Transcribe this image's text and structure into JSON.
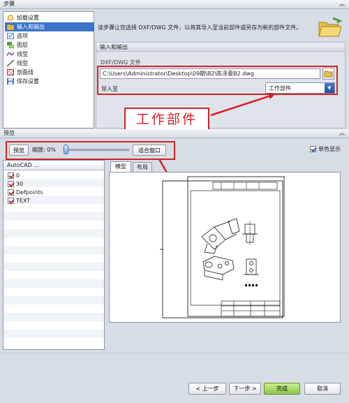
{
  "steps_header": "步骤",
  "steps": [
    {
      "label": "加载设置",
      "icon": "gear-icon",
      "color": "#d79a2b"
    },
    {
      "label": "输入和输出",
      "icon": "folder-icon",
      "color": "#e8b83a"
    },
    {
      "label": "选项",
      "icon": "checklist-icon",
      "color": "#3d7cc9"
    },
    {
      "label": "图层",
      "icon": "layers-icon",
      "color": "#4a9a3a"
    },
    {
      "label": "线型",
      "icon": "linetype-icon",
      "color": "#7a3c9a"
    },
    {
      "label": "线型",
      "icon": "line-icon",
      "color": "#333333"
    },
    {
      "label": "剖面线",
      "icon": "hatch-icon",
      "color": "#c0262d"
    },
    {
      "label": "保存设置",
      "icon": "save-icon",
      "color": "#3d7cc9"
    }
  ],
  "selected_step": 1,
  "description": "该步骤让您选择 DXF/DWG 文件，以将其导入至当前部件或另存为新的部件文件。",
  "io_group_title": "输入和输出",
  "dxf_file_label": "DXF/DWG 文件",
  "file_path": "C:\\Users\\Administrator\\Desktop\\09期\\B2\\陈泽豪B2.dwg",
  "import_to_label": "导入至",
  "import_to_value": "工作部件",
  "callout_text": "工作部件",
  "preview_header": "预览",
  "preview_button": "预览",
  "zoom_label": "缩放: 0%",
  "fit_window_button": "适合窗口",
  "monochrome_label": "单色显示",
  "monochrome_checked": true,
  "layers_header": "AutoCAD ...",
  "layers": [
    {
      "name": "0",
      "checked": true
    },
    {
      "name": "30",
      "checked": true
    },
    {
      "name": "Defpoints",
      "checked": true
    },
    {
      "name": "TEXT",
      "checked": true
    }
  ],
  "tabs": [
    {
      "label": "模型",
      "active": true
    },
    {
      "label": "布局",
      "active": false
    }
  ],
  "footer": {
    "back": "< 上一步",
    "next": "下一步 >",
    "finish": "完成",
    "cancel": "取消"
  },
  "colors": {
    "accent": "#3a73c9",
    "annotation_red": "#d81f26",
    "finish_green": "#9fd35a"
  }
}
